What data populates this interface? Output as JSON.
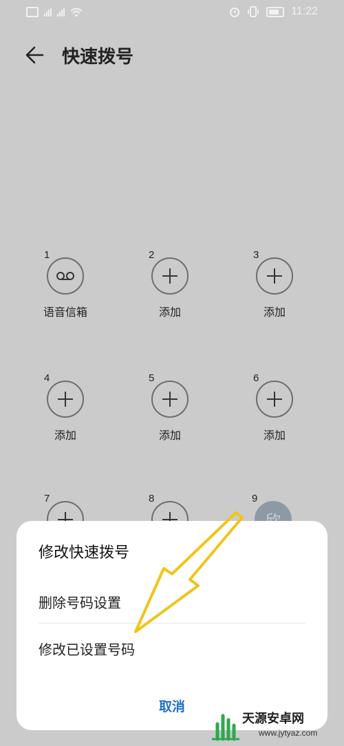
{
  "status_bar": {
    "time": "11:22",
    "icons": [
      "hd-icon",
      "signal-icon",
      "wifi-icon",
      "alarm-icon",
      "vibrate-icon",
      "battery-icon"
    ]
  },
  "header": {
    "title": "快速拨号",
    "back_icon": "arrow-left-icon"
  },
  "speed_dial": [
    {
      "num": "1",
      "label": "语音信箱",
      "icon": "voicemail-icon"
    },
    {
      "num": "2",
      "label": "添加",
      "icon": "plus-icon"
    },
    {
      "num": "3",
      "label": "添加",
      "icon": "plus-icon"
    },
    {
      "num": "4",
      "label": "添加",
      "icon": "plus-icon"
    },
    {
      "num": "5",
      "label": "添加",
      "icon": "plus-icon"
    },
    {
      "num": "6",
      "label": "添加",
      "icon": "plus-icon"
    },
    {
      "num": "7",
      "label": "",
      "icon": "plus-icon"
    },
    {
      "num": "8",
      "label": "",
      "icon": "plus-icon"
    },
    {
      "num": "9",
      "label": "",
      "icon": "contact-avatar",
      "avatar_text": "欣"
    }
  ],
  "sheet": {
    "title": "修改快速拨号",
    "items": [
      "删除号码设置",
      "修改已设置号码"
    ],
    "cancel": "取消"
  },
  "colors": {
    "background_dim": "#cbcbcb",
    "accent": "#1d70c8",
    "annotation": "#f2c418"
  },
  "watermark": {
    "name": "天源安卓网",
    "url": "www.jytyaz.com"
  }
}
